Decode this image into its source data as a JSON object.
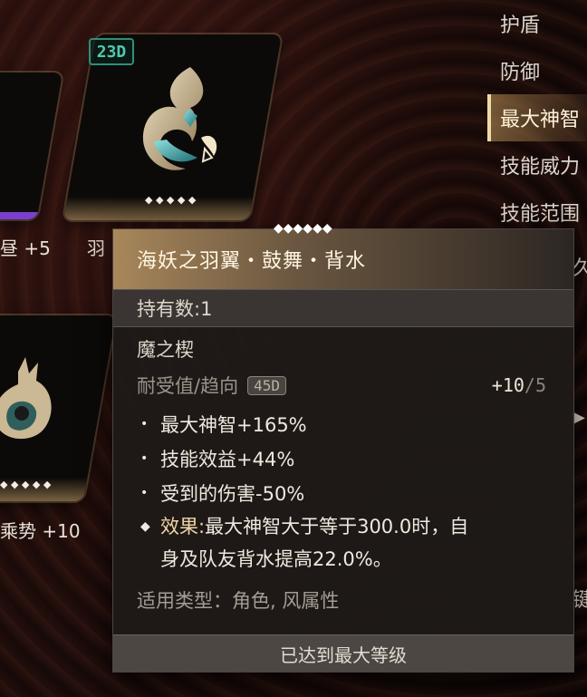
{
  "cards": {
    "main_tag": "23D",
    "main_dots": "◆ ◆ ◆ ◆ ◆",
    "left_top_label": "昼 +5",
    "main_label_fragment": "羽",
    "left_bottom_label": "乘势 +10",
    "left_bottom_dots": "◆ ◆ ◆ ◆ ◆"
  },
  "side_list": {
    "items": [
      "护盾",
      "防御",
      "最大神智",
      "技能威力",
      "技能范围"
    ],
    "active_index": 2
  },
  "tooltip": {
    "title": "海妖之羽翼・鼓舞・背水",
    "diamonds": "◆◆◆◆◆◆",
    "count_label": "持有数:1",
    "item_name": "魔之楔",
    "endurance_label": "耐受值/趋向",
    "endurance_badge": "45D",
    "endurance_value": "+10",
    "endurance_max": "/5",
    "stats": [
      "最大神智+165%",
      "技能效益+44%",
      "受到的伤害-50%"
    ],
    "effect_label": "效果:",
    "effect_line1": "最大神智大于等于300.0时，自",
    "effect_line2": "身及队友背水提高22.0%。",
    "applicable": "适用类型：角色, 风属性",
    "footer": "已达到最大等级"
  },
  "right_fragments": {
    "frag1": "久",
    "frag2": "▶",
    "frag3": "键"
  },
  "colors": {
    "accent_gold": "#a8875a",
    "active_tab": "#f0d9a8",
    "badge_teal": "#52c9ab",
    "rarity_purple": "#7a3fd0"
  }
}
